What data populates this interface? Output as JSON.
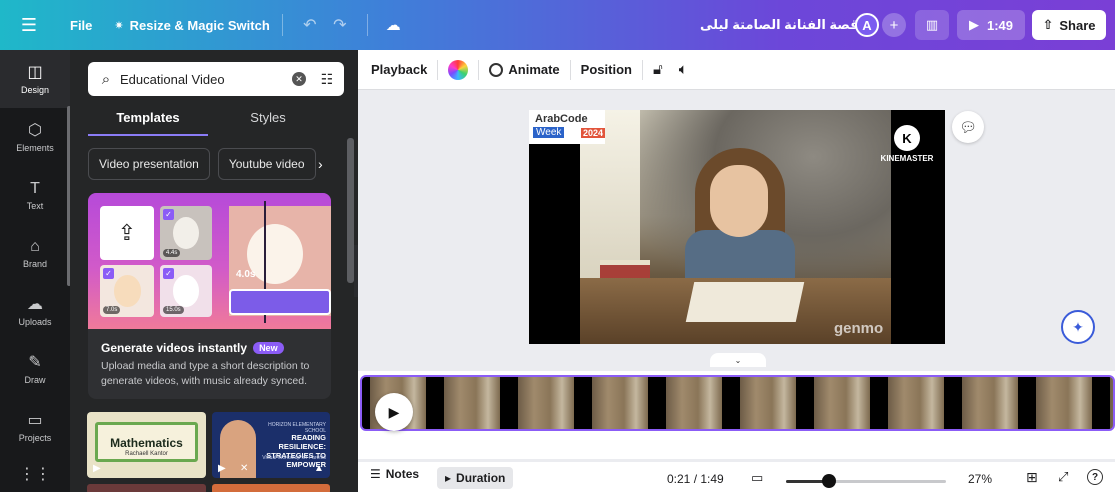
{
  "topbar": {
    "menu_icon": "hamburger-icon",
    "file_label": "File",
    "resize_label": "Resize & Magic Switch",
    "resize_icon": "✷",
    "doc_title": "قصة الفنانة الصامتة ليلى",
    "avatar_initial": "A",
    "add_label": "+",
    "play_time": "1:49",
    "share_label": "Share",
    "gradient_colors": [
      "#1fb8c9",
      "#3f7fd9",
      "#6c47d9",
      "#7a3fd6"
    ]
  },
  "rail": {
    "items": [
      {
        "label": "Design",
        "icon": "design-icon",
        "glyph": "◫"
      },
      {
        "label": "Elements",
        "icon": "elements-icon",
        "glyph": "⬡"
      },
      {
        "label": "Text",
        "icon": "text-icon",
        "glyph": "T"
      },
      {
        "label": "Brand",
        "icon": "brand-icon",
        "glyph": "⌂"
      },
      {
        "label": "Uploads",
        "icon": "uploads-icon",
        "glyph": "☁"
      },
      {
        "label": "Draw",
        "icon": "draw-icon",
        "glyph": "✎"
      },
      {
        "label": "Projects",
        "icon": "projects-icon",
        "glyph": "▭"
      },
      {
        "label": "",
        "icon": "apps-icon",
        "glyph": "⋮⋮"
      }
    ],
    "active": "Design"
  },
  "panel": {
    "search_value": "Educational Video",
    "tabs": [
      {
        "label": "Templates",
        "active": true
      },
      {
        "label": "Styles",
        "active": false
      }
    ],
    "chips": [
      "Video presentation",
      "Youtube video"
    ],
    "promo": {
      "title": "Generate videos instantly",
      "badge": "New",
      "description": "Upload media and type a short description to generate videos, with music already synced.",
      "wave_label": "4.0s",
      "dur_1": "4.4s",
      "dur_2": "7.0s",
      "dur_3": "15.0s"
    },
    "thumbnails": [
      {
        "title": "Mathematics",
        "subtitle": "Rachaell Kantor"
      },
      {
        "header": "HORIZON ELEMENTARY SCHOOL",
        "title": "READING RESILIENCE: STRATEGIES TO EMPOWER",
        "subtitle": "Virtual Workshop for Parents"
      }
    ]
  },
  "context_toolbar": {
    "playback": "Playback",
    "animate": "Animate",
    "position": "Position"
  },
  "canvas": {
    "logo_line1": "ArabCode",
    "logo_line2": "Week",
    "logo_year": "2024",
    "watermark_badge": "K",
    "watermark_text": "KINEMASTER",
    "watermark_genmo": "genmo"
  },
  "bottombar": {
    "notes": "Notes",
    "duration": "Duration",
    "time": "0:21 / 1:49",
    "zoom": "27%",
    "zoom_fraction": 0.27,
    "help": "?"
  }
}
